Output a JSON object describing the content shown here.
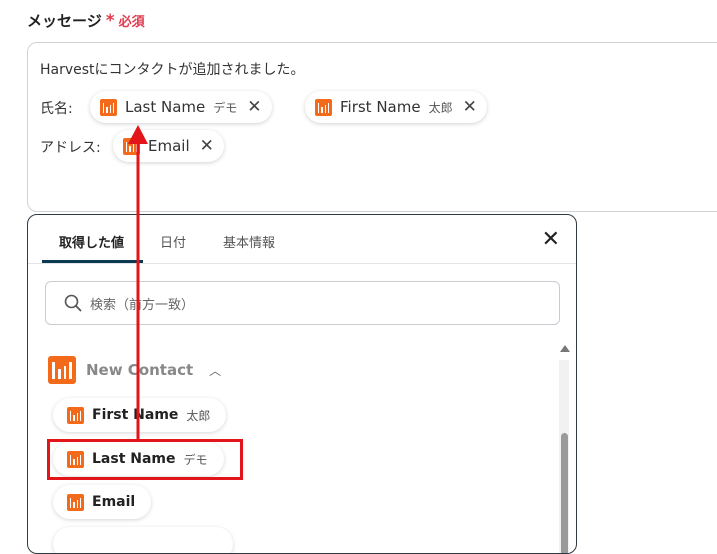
{
  "field": {
    "label": "メッセージ",
    "required_mark": "*",
    "required_text": "必須"
  },
  "message": {
    "line1": "Harvestにコンタクトが追加されました。",
    "row1_label": "氏名:",
    "row2_label": "アドレス:",
    "chips": [
      {
        "name": "Last Name",
        "sample": "デモ"
      },
      {
        "name": "First Name",
        "sample": "太郎"
      },
      {
        "name": "Email",
        "sample": ""
      }
    ]
  },
  "picker": {
    "tabs": [
      "取得した値",
      "日付",
      "基本情報"
    ],
    "active_tab": "取得した値",
    "search_placeholder": "検索（前方一致）",
    "group": {
      "name": "New Contact"
    },
    "items": [
      {
        "name": "First Name",
        "sample": "太郎"
      },
      {
        "name": "Last Name",
        "sample": "デモ"
      },
      {
        "name": "Email",
        "sample": ""
      }
    ]
  },
  "colors": {
    "accent": "#f36a1b",
    "required": "#e03c4f",
    "highlight": "#e3151b",
    "tab_underline": "#0b3a52"
  }
}
